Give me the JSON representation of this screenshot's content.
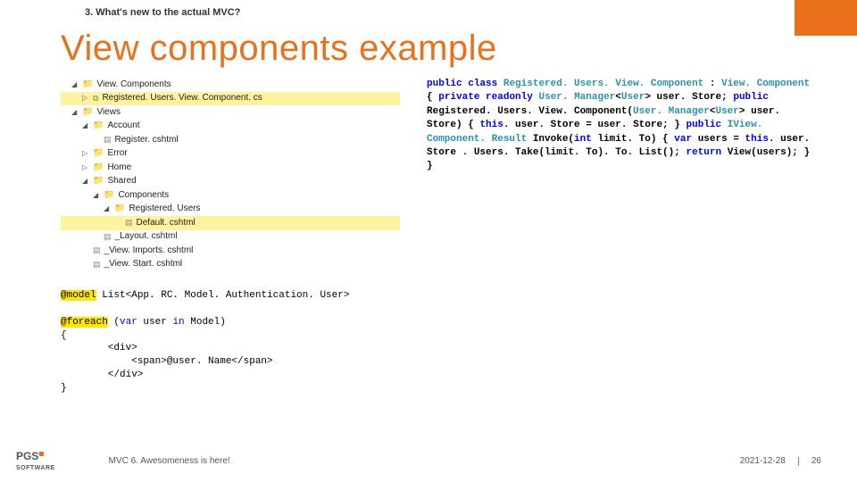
{
  "breadcrumb": "3. What's new to the actual MVC?",
  "title": "View components example",
  "tree": {
    "n0": "View. Components",
    "n1": "Registered. Users. View. Component. cs",
    "n2": "Views",
    "n3": "Account",
    "n4": "Register. cshtml",
    "n5": "Error",
    "n6": "Home",
    "n7": "Shared",
    "n8": "Components",
    "n9": "Registered. Users",
    "n10": "Default. cshtml",
    "n11": "_Layout. cshtml",
    "n12": "_View. Imports. cshtml",
    "n13": "_View. Start. cshtml"
  },
  "razor": {
    "model_kw": "@model",
    "model_type": " List<App. RC. Model. Authentication. User>",
    "foreach_kw": "@foreach",
    "foreach_paren": " (",
    "var_kw": "var",
    "foreach_mid": " user ",
    "in_kw": "in",
    "foreach_end": " Model)",
    "open": "{",
    "div_open": "        <div>",
    "span_line": "            <span>@user. Name</span>",
    "div_close": "        </div>",
    "close": "}"
  },
  "cs": {
    "l1a": "public",
    "l1b": " ",
    "l1c": "class",
    "l1d": " ",
    "l1e": "Registered. Users. View. Component",
    "l1f": " : ",
    "l1g": "View. Component",
    "l2": "{",
    "l3a": "        ",
    "l3b": "private",
    "l3c": " ",
    "l3d": "readonly",
    "l3e": " ",
    "l3f": "User. Manager",
    "l3g": "<",
    "l3h": "User",
    "l3i": "> user. Store;",
    "l5a": "        ",
    "l5b": "public",
    "l6a": "          ",
    "l6b": "Registered. Users. View. Component(",
    "l6c": "User. Manager",
    "l6d": "<",
    "l6e": "User",
    "l6f": ">",
    "l7": "          user. Store)",
    "l8": "        {",
    "l9a": "                ",
    "l9b": "this",
    "l9c": ". user. Store = user. Store;",
    "l10": "        }",
    "l12a": "        ",
    "l12b": "public",
    "l12c": " ",
    "l12d": "IView. Component. Result",
    "l12e": " Invoke(",
    "l12f": "int",
    "l13": "          limit. To)",
    "l14": "        {",
    "l15a": "                ",
    "l15b": "var",
    "l15c": " users = ",
    "l15d": "this",
    "l15e": ". user. Store",
    "l16": "                   . Users. Take(limit. To). To. List();",
    "l17a": "                ",
    "l17b": "return",
    "l17c": " View(users);",
    "l18": "        }",
    "l19": "}"
  },
  "footer": {
    "logo1": "PGS",
    "logo2": "SOFTWARE",
    "tagline": "MVC 6. Awesomeness is here!",
    "date": "2021-12-28",
    "page": "26"
  }
}
